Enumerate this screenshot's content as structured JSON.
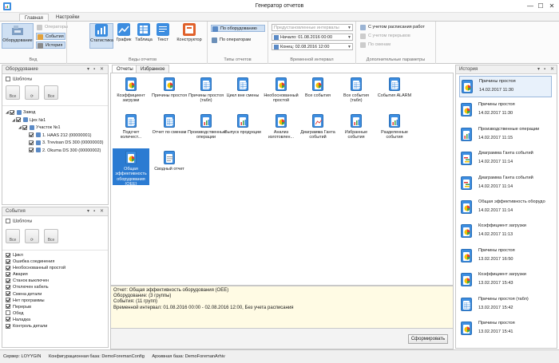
{
  "window": {
    "title": "Генератор отчетов",
    "buttons": {
      "minimize": "—",
      "maximize": "☐",
      "close": "✕"
    }
  },
  "ribbon": {
    "tabs": [
      "Главная",
      "Настройки"
    ],
    "groups": {
      "view": {
        "label": "Вид",
        "equipment": "Оборудование",
        "operators": "Операторы",
        "events": "События",
        "history": "История"
      },
      "report_views": {
        "label": "Виды отчетов",
        "buttons": [
          "Статистика",
          "График",
          "Таблица",
          "Текст",
          "Конструктор"
        ]
      },
      "report_types": {
        "label": "Типы отчетов",
        "by_equipment": "По оборудованию",
        "by_operators": "По операторам"
      },
      "time_interval": {
        "label": "Временной интервал",
        "preset_placeholder": "Предустановленные интервалы",
        "start": "Начало: 01.08.2016 00:00",
        "end": "Конец: 02.08.2016 12:00"
      },
      "extra": {
        "label": "Дополнительные параметры",
        "with_schedule": "С учетом расписания работ",
        "with_breaks": "С учетом перерывов",
        "by_shifts": "По сменам"
      }
    }
  },
  "equipment_panel": {
    "title": "Оборудование",
    "templates": "Шаблоны",
    "tool_labels": [
      "Все",
      "",
      "Все"
    ],
    "tree": [
      {
        "label": "Завод",
        "level": 0,
        "checked": true,
        "expanded": true
      },
      {
        "label": "Цех №1",
        "level": 1,
        "checked": true,
        "expanded": true
      },
      {
        "label": "Участок №1",
        "level": 2,
        "checked": true,
        "expanded": true
      },
      {
        "label": "1. HAAS 212 (00000001)",
        "level": 3,
        "checked": true
      },
      {
        "label": "3. Trevisan DS 300 (00000003)",
        "level": 3,
        "checked": true
      },
      {
        "label": "2. Okuma DS 300 (00000002)",
        "level": 3,
        "checked": true
      }
    ]
  },
  "events_panel": {
    "title": "События",
    "templates": "Шаблоны",
    "tool_labels": [
      "Все",
      "",
      "Все"
    ],
    "items": [
      {
        "label": "Цикл",
        "checked": true
      },
      {
        "label": "Ошибка соединения",
        "checked": true
      },
      {
        "label": "Необоснованный простой",
        "checked": true
      },
      {
        "label": "Авария",
        "checked": true
      },
      {
        "label": "Станок выключен",
        "checked": true
      },
      {
        "label": "Отключен кабель",
        "checked": true
      },
      {
        "label": "Смена детали",
        "checked": true
      },
      {
        "label": "Нет программы",
        "checked": true
      },
      {
        "label": "Перерыв",
        "checked": true
      },
      {
        "label": "Обед",
        "checked": false
      },
      {
        "label": "Наладка",
        "checked": true
      },
      {
        "label": "Контроль детали",
        "checked": true
      }
    ]
  },
  "center": {
    "tabs": [
      "Отчеты",
      "Избранное"
    ],
    "reports": [
      "Коэффициент загрузки",
      "Причины простоя",
      "Причины простоя (табл)",
      "Цикл вне смены",
      "Необоснованный простой",
      "Все события",
      "Все события (табл)",
      "События ALARM",
      "Подсчет количест...",
      "Отчет по сменам",
      "Производственные операции",
      "Выпуск продукции",
      "Анализ изготовлен...",
      "Диаграмма Ганта событий",
      "Избранные события",
      "Разделенные события",
      "Общая эффективность оборудования (OEE)",
      "Сводный отчет"
    ],
    "selected_index": 16,
    "description": [
      "Отчет: Общая эффективность оборудования (OEE)",
      "Оборудование: (3 группы)",
      "События: (11 групп)",
      "Временной интервал: 01.08.2016 00:00 - 02.08.2016 12:00, Без учета расписания"
    ],
    "generate": "Сформировать"
  },
  "history": {
    "title": "История",
    "items": [
      {
        "name": "Причины простоя",
        "time": "14.02.2017 11:30"
      },
      {
        "name": "Причины простоя",
        "time": "14.02.2017 11:30"
      },
      {
        "name": "Производственные операции",
        "time": "14.02.2017 11:15"
      },
      {
        "name": "Диаграмма Ганта событий",
        "time": "14.02.2017 11:14"
      },
      {
        "name": "Диаграмма Ганта событий",
        "time": "14.02.2017 11:14"
      },
      {
        "name": "Общая эффективность оборудо",
        "time": "14.02.2017 11:14"
      },
      {
        "name": "Коэффициент загрузки",
        "time": "14.02.2017 11:13"
      },
      {
        "name": "Причины простоя",
        "time": "13.02.2017 16:50"
      },
      {
        "name": "Коэффициент загрузки",
        "time": "13.02.2017 15:43"
      },
      {
        "name": "Причины простоя (табл)",
        "time": "13.02.2017 15:42"
      },
      {
        "name": "Причины простоя",
        "time": "13.02.2017 15:41"
      }
    ]
  },
  "statusbar": {
    "server": "Сервер: LOYYGIN",
    "config_db": "Конфигурационная база: DemoForemanConfig",
    "archive_db": "Архивная база: DemoForemanArhiv"
  },
  "colors": {
    "accent": "#2b7bd2",
    "doc_blue": "#3c8de0",
    "desc_bg": "#fffbe4"
  }
}
